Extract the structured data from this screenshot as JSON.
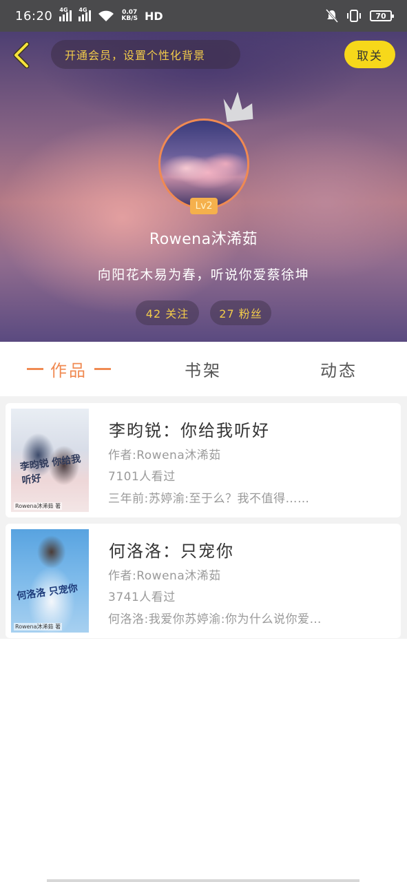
{
  "status_bar": {
    "time": "16:20",
    "net_speed_value": "0.07",
    "net_speed_unit": "KB/S",
    "hd": "HD",
    "sig1_tag": "4G",
    "sig2_tag": "4G",
    "battery": "70"
  },
  "header": {
    "vip_prompt": "开通会员，设置个性化背景",
    "follow_button": "取关",
    "level": "Lv2",
    "username": "Rowena沐浠茹",
    "signature": "向阳花木易为春，听说你爱蔡徐坤",
    "following": "42 关注",
    "fans": "27 粉丝"
  },
  "tabs": [
    {
      "label": "作品",
      "active": true
    },
    {
      "label": "书架",
      "active": false
    },
    {
      "label": "动态",
      "active": false
    }
  ],
  "books": [
    {
      "title": "李昀锐：你给我听好",
      "author": "作者:Rowena沐浠茹",
      "views": "7101人看过",
      "excerpt": "三年前:苏婷渝:至于么？我不值得……",
      "cover_text": "李昀锐 你给我听好",
      "cover_author": "Rowena沐浠茹 著"
    },
    {
      "title": "何洛洛：只宠你",
      "author": "作者:Rowena沐浠茹",
      "views": "3741人看过",
      "excerpt": "何洛洛:我爱你苏婷渝:你为什么说你爱…",
      "cover_text": "何洛洛 只宠你",
      "cover_author": "Rowena沐浠茹 著"
    }
  ],
  "colors": {
    "accent": "#f08a52",
    "follow_button": "#f7d81a",
    "gold_text": "#f3cc4a"
  }
}
